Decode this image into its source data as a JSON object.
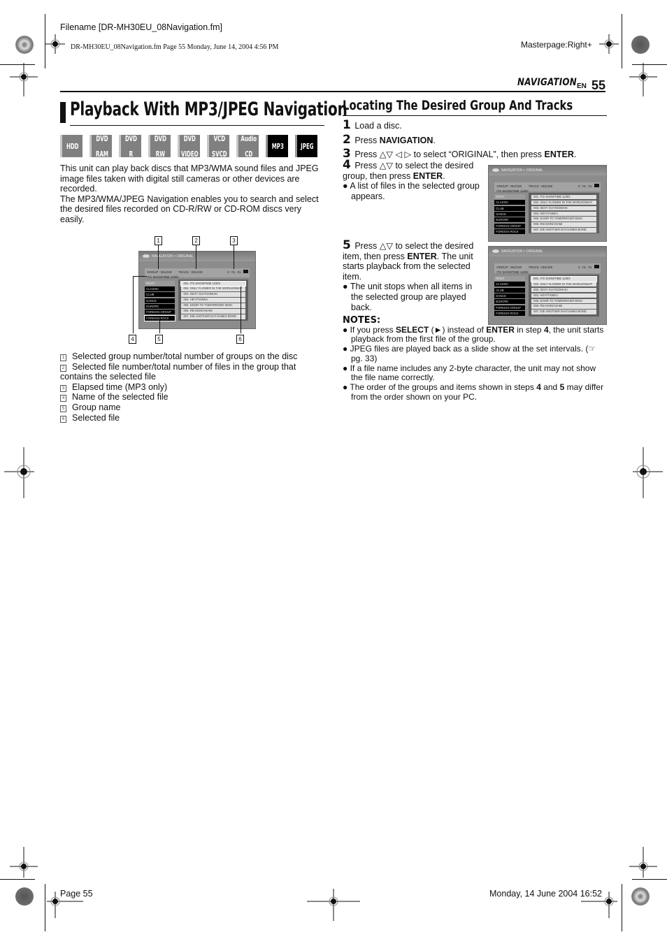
{
  "print_header": {
    "filename": "Filename [DR-MH30EU_08Navigation.fm]",
    "fm_line": "DR-MH30EU_08Navigation.fm  Page 55  Monday, June 14, 2004  4:56 PM",
    "masterpage": "Masterpage:Right+"
  },
  "running_header": {
    "section": "NAVIGATION",
    "lang": "EN",
    "page": "55"
  },
  "left": {
    "title": "Playback With MP3/JPEG Navigation",
    "badges": [
      {
        "label1": "HDD",
        "label2": "",
        "active": false
      },
      {
        "label1": "DVD",
        "label2": "RAM",
        "active": false
      },
      {
        "label1": "DVD",
        "label2": "R",
        "active": false
      },
      {
        "label1": "DVD",
        "label2": "RW",
        "active": false
      },
      {
        "label1": "DVD",
        "label2": "VIDEO",
        "active": false
      },
      {
        "label1": "VCD",
        "label2": "SVCD",
        "active": false
      },
      {
        "label1": "Audio",
        "label2": "CD",
        "active": false
      },
      {
        "label1": "MP3",
        "label2": "",
        "active": true
      },
      {
        "label1": "JPEG",
        "label2": "",
        "active": true
      }
    ],
    "intro_p1": "This unit can play back discs that MP3/WMA sound files and JPEG image files taken with digital still cameras or other devices are recorded.",
    "intro_p2": "The MP3/WMA/JPEG Navigation enables you to search and select the desired files recorded on CD-R/RW or CD-ROM discs very easily.",
    "callouts": [
      "1",
      "2",
      "3",
      "4",
      "5",
      "6"
    ],
    "legend": [
      {
        "num": "1",
        "text": "Selected group number/total number of groups on the disc"
      },
      {
        "num": "2",
        "text": "Selected file number/total number of files in the group that contains the selected file"
      },
      {
        "num": "3",
        "text": "Elapsed time (MP3 only)"
      },
      {
        "num": "4",
        "text": "Name of the selected file"
      },
      {
        "num": "5",
        "text": "Group name"
      },
      {
        "num": "6",
        "text": "Selected file"
      }
    ]
  },
  "screen": {
    "title": "NAVIGATION > ORIGINAL",
    "group": "GROUP : 001/100",
    "track": "TRACK : 001/100",
    "elapsed": "0 : 01 : 01",
    "now_playing": "ITS SHOWTIME 11/8/2",
    "groups": [
      "ROOT",
      "CLASSIC",
      "CLUB",
      "DANCE",
      "EUROPE",
      "FOREIGN GROUP",
      "FOREIGN ROCK"
    ],
    "files": [
      "001.  ITS SHOWTIME 11/8/2",
      "002.  ONLY FLOWER IN THE WORLD/SMAP",
      "003.  SEXY GUY/GOMAKI",
      "004.  HEY!/YAWKA",
      "005.  DOOR TO TOMORROW/I WISH",
      "006.  REASON/ASAMI",
      "007.  DIE ANOTHER DAY/JAMES BOND"
    ]
  },
  "right": {
    "heading": "Locating The Desired Group And Tracks",
    "steps": [
      {
        "num": "1",
        "pre": "Load a disc.",
        "bold": "",
        "post": ""
      },
      {
        "num": "2",
        "pre": "Press ",
        "bold": "NAVIGATION",
        "post": "."
      },
      {
        "num": "3",
        "pre": "Press △▽ ◁ ▷ to select “ORIGINAL”, then press ",
        "bold": "ENTER",
        "post": "."
      }
    ],
    "step4": {
      "num": "4",
      "line1": "Press △▽ to select the desired",
      "line2_pre": "group, then press ",
      "line2_bold": "ENTER",
      "line2_post": ".",
      "bullet": "A list of files in the selected group appears."
    },
    "step5": {
      "num": "5",
      "pre": "Press △▽ to select the desired item, then press ",
      "bold": "ENTER",
      "post": ". The unit starts playback from the selected item.",
      "bullet": "The unit stops when all items in the selected group are played back."
    },
    "notes": {
      "heading": "NOTES:",
      "n1_a": "If you press ",
      "n1_b": "SELECT",
      "n1_c": " (►) instead of ",
      "n1_d": "ENTER",
      "n1_e": " in step ",
      "n1_f": "4",
      "n1_g": ", the unit starts playback from the first file of the group.",
      "n2": "JPEG files are played back as a slide show at the set intervals. (☞ pg. 33)",
      "n3": "If a file name includes any 2-byte character, the unit may not show the file name correctly.",
      "n4_a": "The order of the groups and items shown in steps ",
      "n4_b": "4",
      "n4_c": " and ",
      "n4_d": "5",
      "n4_e": " may differ from the order shown on your PC."
    }
  },
  "print_footer": {
    "page": "Page 55",
    "date": "Monday, 14 June 2004  16:52"
  }
}
